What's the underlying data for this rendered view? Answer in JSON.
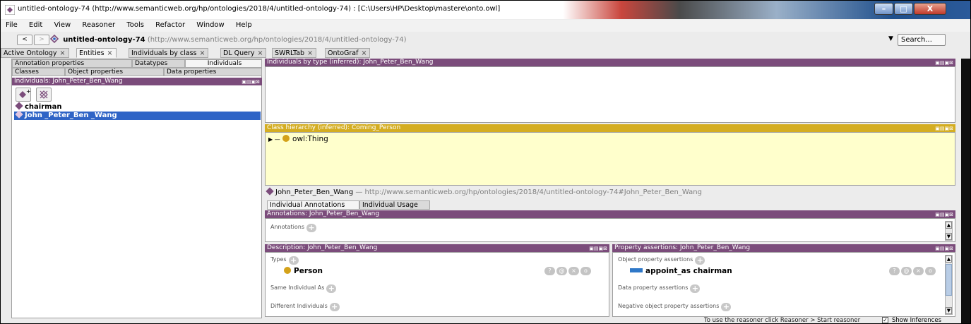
{
  "window": {
    "title": "untitled-ontology-74 (http://www.semanticweb.org/hp/ontologies/2018/4/untitled-ontology-74)  : [C:\\Users\\HP\\Desktop\\mastere\\onto.owl]",
    "min": "–",
    "max": "□",
    "close": "X"
  },
  "menu": [
    "File",
    "Edit",
    "View",
    "Reasoner",
    "Tools",
    "Refactor",
    "Window",
    "Help"
  ],
  "address": {
    "back": "<",
    "forward": ">",
    "ontology_name": "untitled-ontology-74",
    "ontology_iri": "(http://www.semanticweb.org/hp/ontologies/2018/4/untitled-ontology-74)",
    "search_label": "Search..."
  },
  "tabs": [
    {
      "label": "Active Ontology"
    },
    {
      "label": "Entities"
    },
    {
      "label": "Individuals by class"
    },
    {
      "label": "DL Query"
    },
    {
      "label": "SWRLTab"
    },
    {
      "label": "OntoGraf"
    }
  ],
  "left": {
    "subtabs_row1": [
      "Annotation properties",
      "Datatypes",
      "Individuals"
    ],
    "subtabs_row2": [
      "Classes",
      "Object properties",
      "Data properties"
    ],
    "header": "Individuals: John_Peter_Ben_Wang",
    "individuals": [
      "chairman",
      "John _Peter_Ben _Wang"
    ]
  },
  "panels": {
    "by_type": "Individuals by type (inferred): John_Peter_Ben_Wang",
    "class_hierarchy": "Class hierarchy (inferred): Coming_Person",
    "owl_thing": "owl:Thing",
    "entity_name": "John_Peter_Ben_Wang",
    "entity_iri": "— http://www.semanticweb.org/hp/ontologies/2018/4/untitled-ontology-74#John_Peter_Ben_Wang",
    "ind_tabs": [
      "Individual Annotations",
      "Individual Usage"
    ],
    "annotations_header": "Annotations: John_Peter_Ben_Wang",
    "annotations_label": "Annotations",
    "description_header": "Description: John_Peter_Ben_Wang",
    "types_label": "Types",
    "type_value": "Person",
    "same_as_label": "Same Individual As",
    "different_label": "Different Individuals",
    "property_header": "Property assertions: John_Peter_Ben_Wang",
    "object_prop_label": "Object property assertions",
    "object_prop_value": "appoint_as  chairman",
    "data_prop_label": "Data property assertions",
    "neg_obj_label": "Negative object property assertions"
  },
  "status": {
    "text": "To use the reasoner click Reasoner > Start reasoner",
    "show_inferences": "Show Inferences"
  },
  "colors": {
    "panel_header": "#7b4c7b",
    "hierarchy_header": "#d4ad22",
    "hierarchy_body": "#ffffcc",
    "selection": "#2f64c6"
  }
}
